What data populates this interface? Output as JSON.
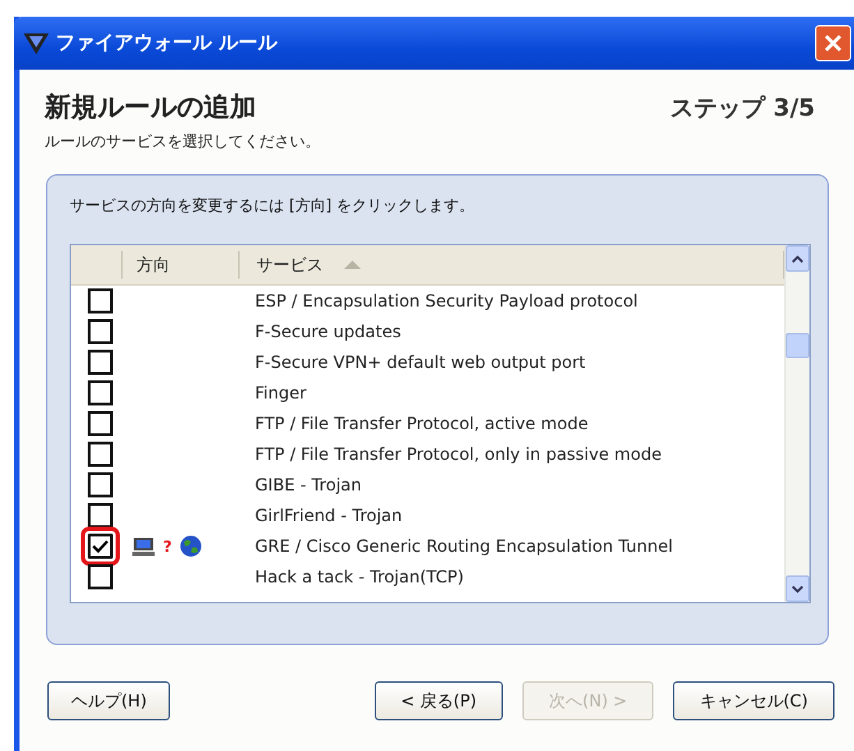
{
  "window": {
    "title": "ファイアウォール ルール"
  },
  "header": {
    "title": "新規ルールの追加",
    "step": "ステップ 3/5",
    "subtitle": "ルールのサービスを選択してください。"
  },
  "instruction": "サービスの方向を変更するには [方向] をクリックします。",
  "table": {
    "columns": [
      "方向",
      "サービス"
    ],
    "rows": [
      {
        "service": "ESP / Encapsulation Security Payload protocol",
        "checked": false,
        "highlighted": false
      },
      {
        "service": "F-Secure updates",
        "checked": false,
        "highlighted": false
      },
      {
        "service": "F-Secure VPN+ default web output port",
        "checked": false,
        "highlighted": false
      },
      {
        "service": "Finger",
        "checked": false,
        "highlighted": false
      },
      {
        "service": "FTP / File Transfer Protocol, active mode",
        "checked": false,
        "highlighted": false
      },
      {
        "service": "FTP / File Transfer Protocol, only in passive mode",
        "checked": false,
        "highlighted": false
      },
      {
        "service": "GIBE - Trojan",
        "checked": false,
        "highlighted": false
      },
      {
        "service": "GirlFriend - Trojan",
        "checked": false,
        "highlighted": false
      },
      {
        "service": "GRE / Cisco Generic Routing Encapsulation Tunnel",
        "checked": true,
        "highlighted": true,
        "direction_mark": "?"
      },
      {
        "service": "Hack a tack - Trojan(TCP)",
        "checked": false,
        "highlighted": false
      }
    ]
  },
  "buttons": [
    {
      "label": "ヘルプ(H)",
      "disabled": false
    },
    {
      "label": "< 戻る(P)",
      "disabled": false
    },
    {
      "label": "次へ(N) >",
      "disabled": true
    },
    {
      "label": "キャンセル(C)",
      "disabled": false
    }
  ]
}
